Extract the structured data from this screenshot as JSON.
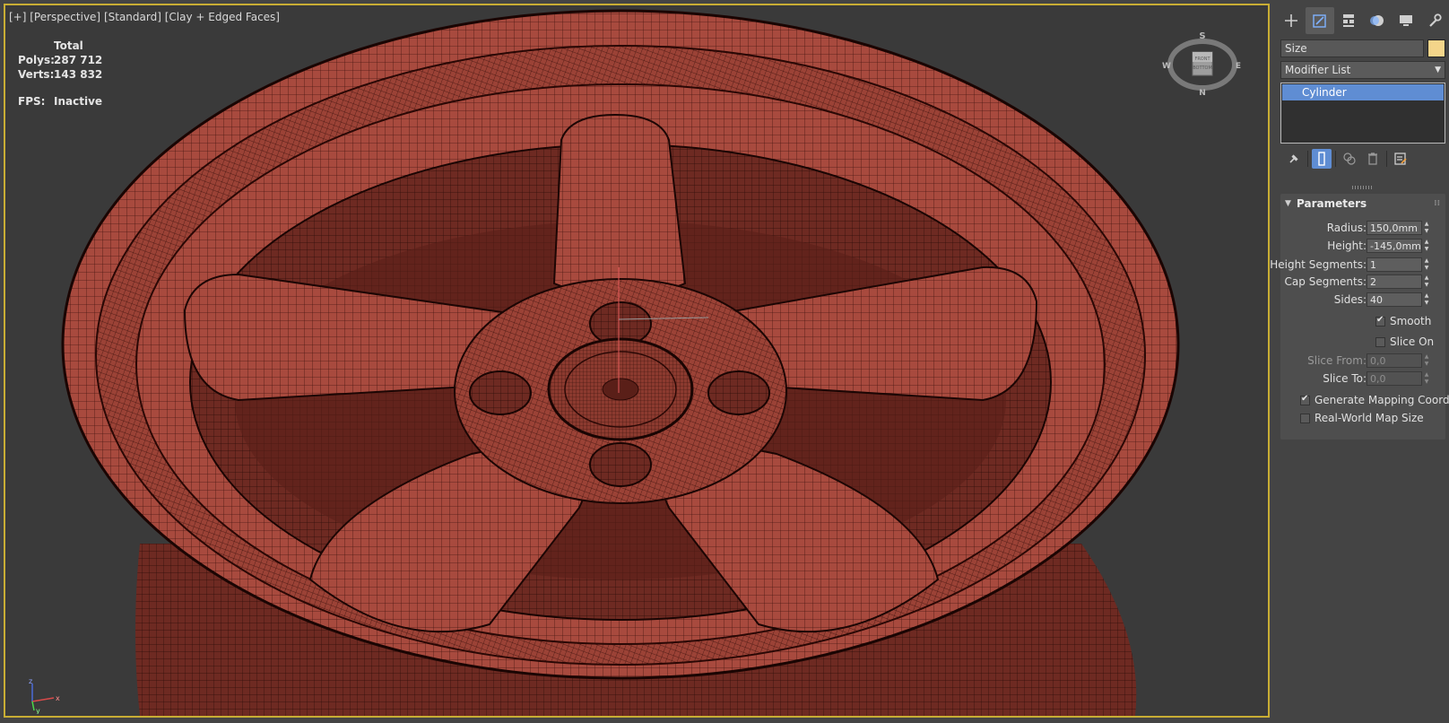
{
  "viewport": {
    "label_parts": [
      "[+]",
      "[Perspective]",
      "[Standard]",
      "[Clay + Edged Faces]"
    ],
    "stats": {
      "header": "Total",
      "polys_label": "Polys:",
      "polys_value": "287 712",
      "verts_label": "Verts:",
      "verts_value": "143 832",
      "fps_label": "FPS:",
      "fps_value": "Inactive"
    },
    "viewcube": {
      "top": "S",
      "left": "W",
      "right": "E",
      "bottom": "N",
      "face_top": "FRONT",
      "face_bottom": "BOTTOM"
    },
    "axes": {
      "x": "x",
      "y": "y",
      "z": "z"
    },
    "mesh_color": "#a84a3e",
    "border_color": "#c8ad34"
  },
  "panel": {
    "tabs": [
      {
        "icon": "create-icon"
      },
      {
        "icon": "modify-icon",
        "active": true
      },
      {
        "icon": "hierarchy-icon"
      },
      {
        "icon": "motion-icon"
      },
      {
        "icon": "display-icon"
      },
      {
        "icon": "utilities-icon"
      }
    ],
    "object_name": "Size",
    "object_color": "#f4d58a",
    "modifier_list": "Modifier List",
    "stack_items": [
      "Cylinder"
    ],
    "rollout_title": "Parameters",
    "params": {
      "radius_label": "Radius:",
      "radius_value": "150,0mm",
      "height_label": "Height:",
      "height_value": "-145,0mm",
      "height_segments_label": "Height Segments:",
      "height_segments_value": "1",
      "cap_segments_label": "Cap Segments:",
      "cap_segments_value": "2",
      "sides_label": "Sides:",
      "sides_value": "40",
      "smooth_label": "Smooth",
      "smooth_checked": true,
      "slice_on_label": "Slice On",
      "slice_on_checked": false,
      "slice_from_label": "Slice From:",
      "slice_from_value": "0,0",
      "slice_to_label": "Slice To:",
      "slice_to_value": "0,0",
      "gen_mapping_label": "Generate Mapping Coords.",
      "gen_mapping_checked": true,
      "real_world_label": "Real-World Map Size",
      "real_world_checked": false
    }
  }
}
